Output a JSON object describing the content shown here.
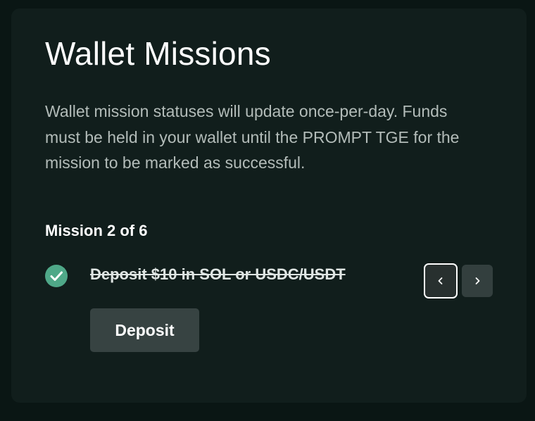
{
  "card": {
    "title": "Wallet Missions",
    "description": "Wallet mission statuses will update once-per-day. Funds must be held in your wallet until the PROMPT TGE for the mission to be marked as successful."
  },
  "mission": {
    "counter": "Mission 2 of 6",
    "task_label": "Deposit $10 in SOL or USDC/USDT",
    "completed": true,
    "action_label": "Deposit"
  },
  "navigation": {
    "prev_icon": "chevron-left-icon",
    "next_icon": "chevron-right-icon"
  },
  "colors": {
    "page_background": "#0a1614",
    "card_background": "#111e1c",
    "check_green": "#4fa888",
    "button_background": "#374342",
    "text_primary": "#ffffff",
    "text_secondary": "#b3bcb9"
  }
}
